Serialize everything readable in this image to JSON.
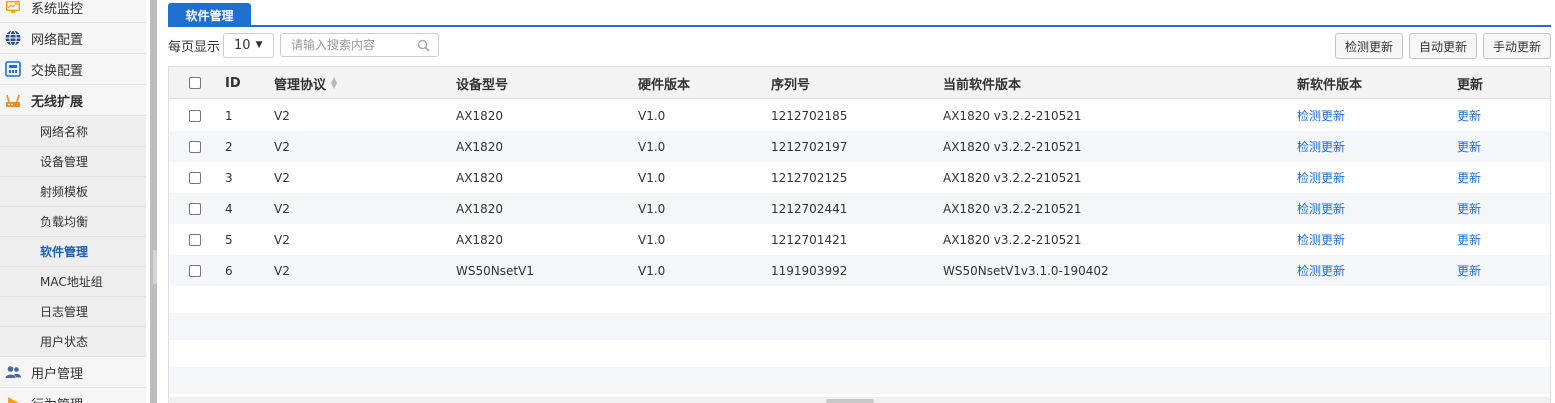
{
  "sidebar": {
    "items": [
      {
        "label": "系统监控",
        "icon": "monitor-icon"
      },
      {
        "label": "网络配置",
        "icon": "globe-icon"
      },
      {
        "label": "交换配置",
        "icon": "switch-icon"
      },
      {
        "label": "无线扩展",
        "icon": "router-icon"
      },
      {
        "label": "网络名称"
      },
      {
        "label": "设备管理"
      },
      {
        "label": "射频模板"
      },
      {
        "label": "负载均衡"
      },
      {
        "label": "软件管理"
      },
      {
        "label": "MAC地址组"
      },
      {
        "label": "日志管理"
      },
      {
        "label": "用户状态"
      },
      {
        "label": "用户管理",
        "icon": "users-icon"
      },
      {
        "label": "行为管理",
        "icon": "behavior-icon"
      }
    ]
  },
  "tabs": [
    {
      "label": "软件管理"
    }
  ],
  "toolbar": {
    "per_page_label": "每页显示",
    "page_size": "10",
    "search_placeholder": "请输入搜索内容",
    "buttons": [
      "检测更新",
      "自动更新",
      "手动更新"
    ]
  },
  "table": {
    "headers": [
      "ID",
      "管理协议",
      "设备型号",
      "硬件版本",
      "序列号",
      "当前软件版本",
      "新软件版本",
      "更新"
    ],
    "rows": [
      [
        "1",
        "V2",
        "AX1820",
        "V1.0",
        "1212702185",
        "AX1820 v3.2.2-210521",
        "检测更新",
        "更新"
      ],
      [
        "2",
        "V2",
        "AX1820",
        "V1.0",
        "1212702197",
        "AX1820 v3.2.2-210521",
        "检测更新",
        "更新"
      ],
      [
        "3",
        "V2",
        "AX1820",
        "V1.0",
        "1212702125",
        "AX1820 v3.2.2-210521",
        "检测更新",
        "更新"
      ],
      [
        "4",
        "V2",
        "AX1820",
        "V1.0",
        "1212702441",
        "AX1820 v3.2.2-210521",
        "检测更新",
        "更新"
      ],
      [
        "5",
        "V2",
        "AX1820",
        "V1.0",
        "1212701421",
        "AX1820 v3.2.2-210521",
        "检测更新",
        "更新"
      ],
      [
        "6",
        "V2",
        "WS50NsetV1",
        "V1.0",
        "1191903992",
        "WS50NsetV1v3.1.0-190402",
        "检测更新",
        "更新"
      ]
    ]
  },
  "colors": {
    "accent": "#1d6fd0",
    "row_stripe": "#f4f6fa",
    "sidebar_bg": "#f5f5f5"
  }
}
